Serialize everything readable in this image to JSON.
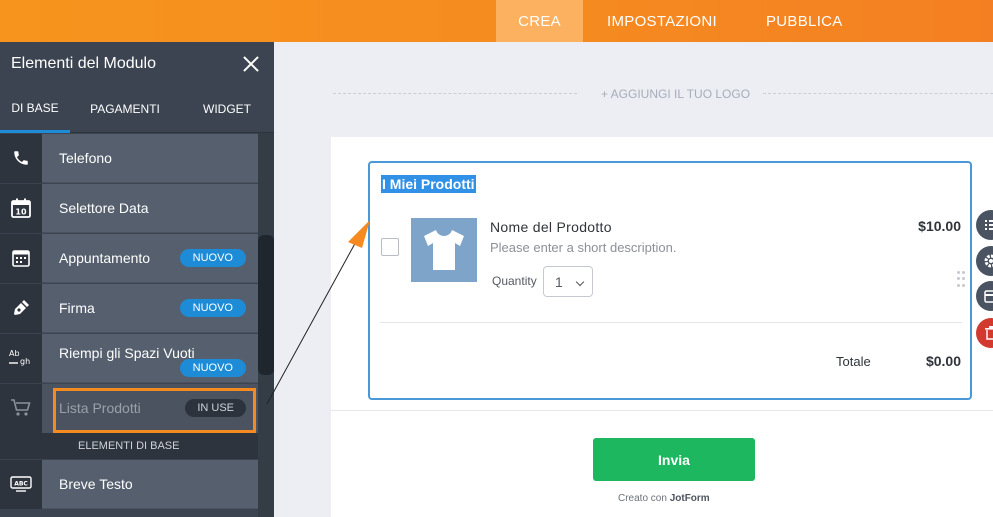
{
  "topnav": {
    "tabs": [
      {
        "label": "CREA",
        "active": true
      },
      {
        "label": "IMPOSTAZIONI",
        "active": false
      },
      {
        "label": "PUBBLICA",
        "active": false
      }
    ]
  },
  "sidebar": {
    "title": "Elementi del Modulo",
    "tabs": [
      {
        "label": "DI BASE",
        "active": true
      },
      {
        "label": "PAGAMENTI",
        "active": false
      },
      {
        "label": "WIDGET",
        "active": false
      }
    ],
    "items": [
      {
        "label": "Telefono",
        "icon": "phone-icon"
      },
      {
        "label": "Selettore Data",
        "icon": "calendar-icon"
      },
      {
        "label": "Appuntamento",
        "icon": "appointment-icon",
        "badge": "NUOVO"
      },
      {
        "label": "Firma",
        "icon": "signature-icon",
        "badge": "NUOVO"
      },
      {
        "label": "Riempi gli Spazi Vuoti",
        "icon": "fill-blank-icon",
        "badge": "NUOVO"
      },
      {
        "label": "Lista Prodotti",
        "icon": "cart-icon",
        "status": "IN USE"
      }
    ],
    "section_header": "ELEMENTI DI BASE",
    "items_after": [
      {
        "label": "Breve Testo",
        "icon": "short-text-icon"
      }
    ],
    "icon_text": {
      "calendar": "10",
      "abc_top": "Ab",
      "abc_bottom": "gh",
      "short_text": "ABC"
    }
  },
  "main": {
    "logo_placeholder": "+ AGGIUNGI IL TUO LOGO",
    "product_list": {
      "title": "I Miei Prodotti",
      "product": {
        "name": "Nome del Prodotto",
        "description": "Please enter a short description.",
        "quantity_label": "Quantity",
        "quantity_value": "1",
        "price": "$10.00"
      },
      "total_label": "Totale",
      "total_value": "$0.00"
    },
    "submit_label": "Invia",
    "credit_prefix": "Creato con",
    "credit_brand": "JotForm"
  },
  "colors": {
    "topbar": "#f58a20",
    "active_tab": "#fbb15f",
    "sidebar_bg": "#3b4450",
    "badge": "#1e8bd6",
    "highlight": "#f58a20",
    "submit": "#1cb75e",
    "question_border": "#4a98d7",
    "delete": "#d23a2f"
  }
}
